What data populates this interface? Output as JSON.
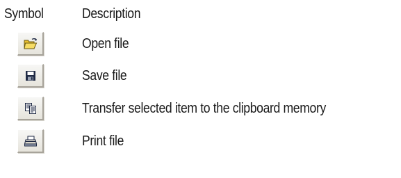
{
  "header": {
    "symbol_label": "Symbol",
    "description_label": "Description"
  },
  "rows": [
    {
      "icon": "open-folder-icon",
      "description": "Open file"
    },
    {
      "icon": "save-disk-icon",
      "description": "Save file"
    },
    {
      "icon": "copy-clipboard-icon",
      "description": "Transfer selected item to the clipboard memory"
    },
    {
      "icon": "printer-icon",
      "description": "Print file"
    }
  ],
  "colors": {
    "folder_yellow": "#f2d24a",
    "folder_outline": "#6b5a12",
    "icon_dark": "#1f2a44",
    "button_face": "#ece9d8"
  }
}
